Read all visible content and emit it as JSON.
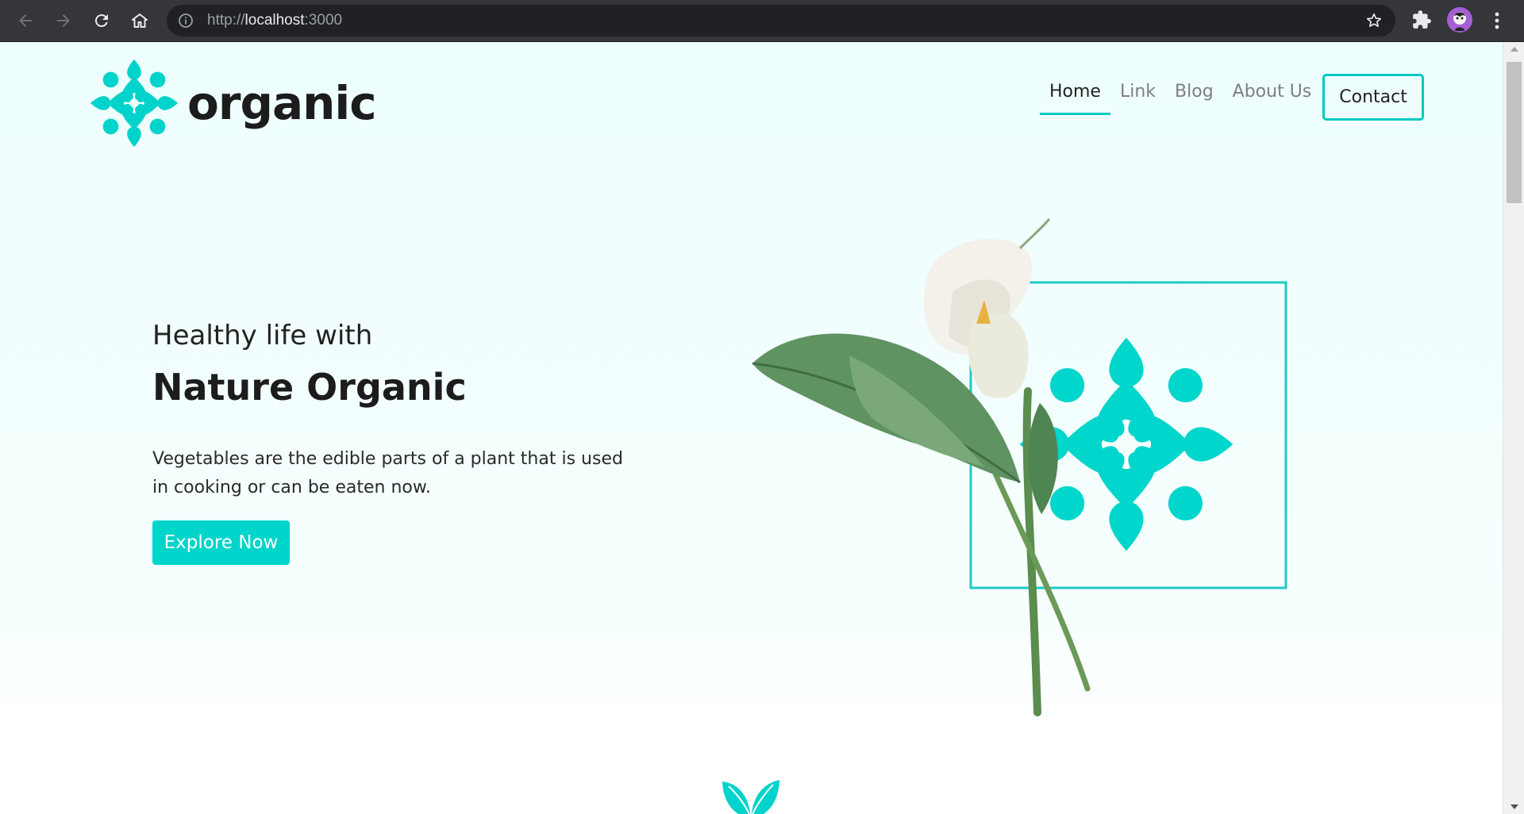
{
  "browser": {
    "url_scheme": "http://",
    "url_host": "localhost",
    "url_port": ":3000",
    "icons": [
      "back-icon",
      "forward-icon",
      "reload-icon",
      "home-icon",
      "site-info-icon",
      "bookmark-star-icon",
      "extensions-icon",
      "profile-avatar",
      "menu-icon"
    ]
  },
  "header": {
    "logo_text": "organic",
    "nav": [
      {
        "label": "Home",
        "active": true
      },
      {
        "label": "Link",
        "active": false
      },
      {
        "label": "Blog",
        "active": false
      },
      {
        "label": "About Us",
        "active": false
      }
    ],
    "contact_label": "Contact"
  },
  "hero": {
    "subtitle": "Healthy life with",
    "title": "Nature Organic",
    "description": "Vegetables are the edible parts of a plant that is used in cooking or can be eaten now.",
    "cta_label": "Explore Now"
  },
  "colors": {
    "accent": "#00c9c2",
    "button": "#00d5cb",
    "chrome": "#35363a"
  }
}
